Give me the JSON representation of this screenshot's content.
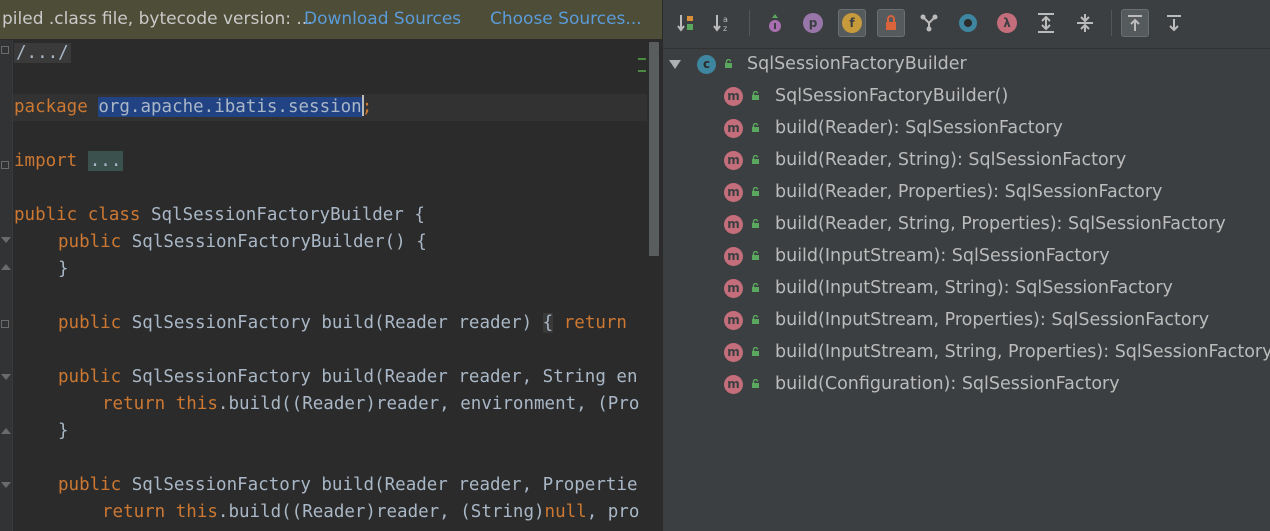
{
  "banner": {
    "message": "piled .class file, bytecode version: ...",
    "download_sources": "Download Sources",
    "choose_sources": "Choose Sources..."
  },
  "code": {
    "line1": "/.../",
    "package_kw": "package",
    "package_name": "org.apache.ibatis.session",
    "package_semicolon": ";",
    "import_kw": "import",
    "import_folded": "...",
    "class_decl_kw": "public class",
    "class_decl_rest": " SqlSessionFactoryBuilder {",
    "ctor_kw": "public",
    "ctor_rest": " SqlSessionFactoryBuilder() {",
    "close_brace": "}",
    "m1_kw": "public",
    "m1_rest": " SqlSessionFactory build(Reader reader) ",
    "m1_brace": "{",
    "m1_return": "return",
    "m2_kw": "public",
    "m2_rest": " SqlSessionFactory build(Reader reader, String en",
    "m2_body_kw": "return",
    "m2_body_this": "this",
    "m2_body_rest": ".build((Reader)reader, environment, (Pro",
    "m2_close": "}",
    "m3_kw": "public",
    "m3_rest": " SqlSessionFactory build(Reader reader, Propertie",
    "m3_body_kw": "return",
    "m3_body_this": "this",
    "m3_body_rest": ".build((Reader)reader, (String)",
    "m3_body_null": "null",
    "m3_body_tail": ", pro"
  },
  "toolbar": {
    "items": [
      {
        "name": "sort-by-visibility-icon",
        "active": false
      },
      {
        "name": "sort-alphabetically-icon",
        "active": false
      },
      {
        "name": "show-inherited-icon",
        "active": false
      },
      {
        "name": "show-properties-icon",
        "active": false,
        "glyph": "p"
      },
      {
        "name": "show-fields-icon",
        "active": true,
        "glyph": "f"
      },
      {
        "name": "show-non-public-icon",
        "active": true
      },
      {
        "name": "show-anonymous-icon",
        "active": false
      },
      {
        "name": "show-interfaces-icon",
        "active": false
      },
      {
        "name": "show-lambdas-icon",
        "active": false,
        "glyph": "λ"
      },
      {
        "name": "expand-all-icon",
        "active": false
      },
      {
        "name": "collapse-all-icon",
        "active": false
      },
      {
        "name": "autoscroll-to-source-icon",
        "active": true
      },
      {
        "name": "autoscroll-from-source-icon",
        "active": false
      }
    ]
  },
  "tree": {
    "class_icon_letter": "c",
    "method_icon_letter": "m",
    "class_name": "SqlSessionFactoryBuilder",
    "methods": [
      "SqlSessionFactoryBuilder()",
      "build(Reader): SqlSessionFactory",
      "build(Reader, String): SqlSessionFactory",
      "build(Reader, Properties): SqlSessionFactory",
      "build(Reader, String, Properties): SqlSessionFactory",
      "build(InputStream): SqlSessionFactory",
      "build(InputStream, String): SqlSessionFactory",
      "build(InputStream, Properties): SqlSessionFactory",
      "build(InputStream, String, Properties): SqlSessionFactory",
      "build(Configuration): SqlSessionFactory"
    ]
  },
  "colors": {
    "method_icon": "#c36e7a",
    "class_icon": "#3e86a0",
    "keyword": "#cc7832",
    "link": "#5a9bd8",
    "selection": "#214283"
  }
}
